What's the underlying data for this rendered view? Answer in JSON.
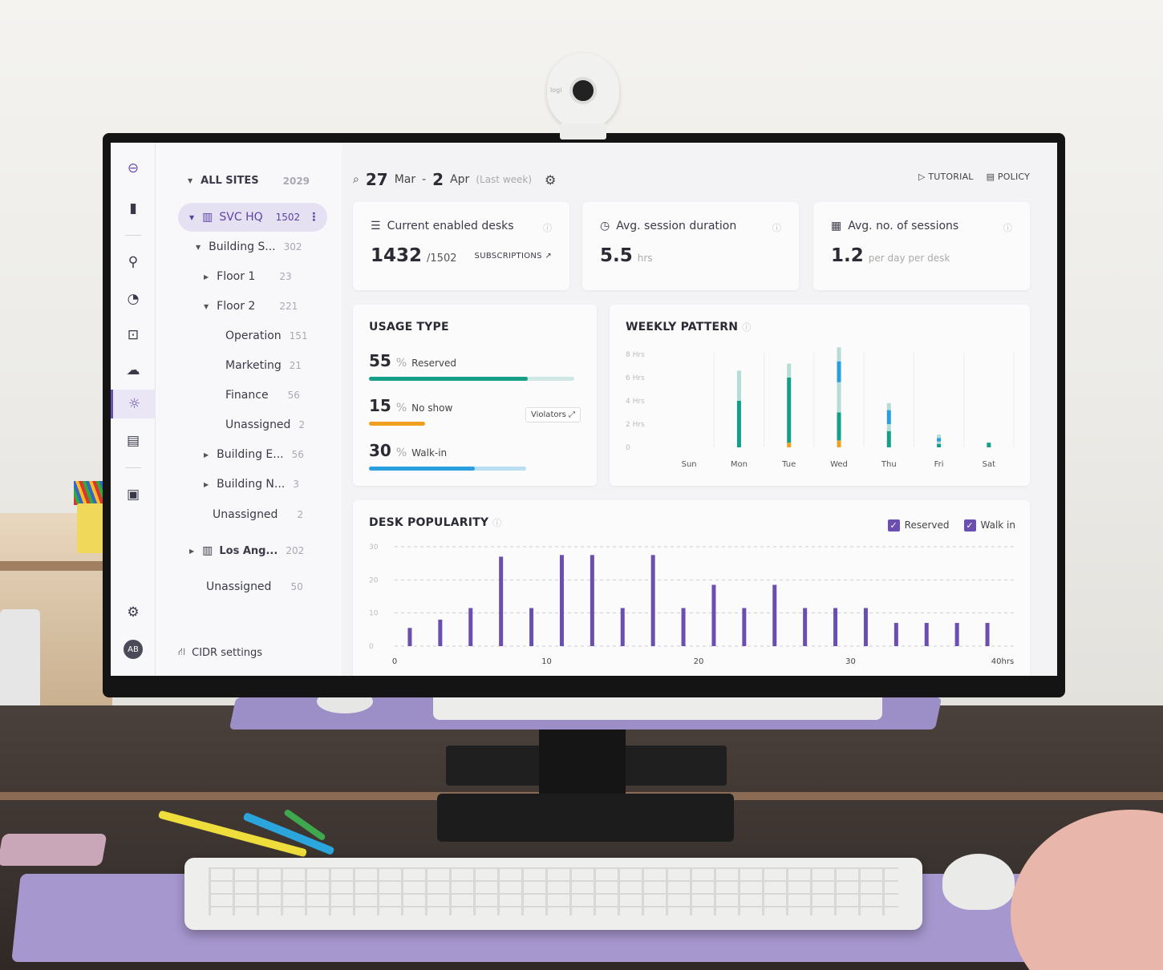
{
  "sidebar": {
    "sites_header": {
      "label": "ALL SITES",
      "count": "2029"
    },
    "tree": [
      {
        "label": "SVC HQ",
        "count": "1502"
      },
      {
        "label": "Building S...",
        "count": "302"
      },
      {
        "label": "Floor 1",
        "count": "23"
      },
      {
        "label": "Floor 2",
        "count": "221"
      },
      {
        "label": "Operation",
        "count": "151"
      },
      {
        "label": "Marketing",
        "count": "21"
      },
      {
        "label": "Finance",
        "count": "56"
      },
      {
        "label": "Unassigned",
        "count": "2"
      },
      {
        "label": "Building E...",
        "count": "56"
      },
      {
        "label": "Building N...",
        "count": "3"
      },
      {
        "label": "Unassigned",
        "count": "2"
      },
      {
        "label": "Los Ang...",
        "count": "202"
      },
      {
        "label": "Unassigned",
        "count": "50"
      }
    ],
    "cidr_label": "CIDR settings",
    "avatar": "AB"
  },
  "header": {
    "date_start_day": "27",
    "date_start_month": "Mar",
    "date_end_day": "2",
    "date_end_month": "Apr",
    "range_label": "(Last week)",
    "tutorial": "TUTORIAL",
    "policy": "POLICY"
  },
  "kpis": {
    "desks": {
      "title": "Current enabled desks",
      "value": "1432",
      "total": "/1502",
      "link": "SUBSCRIPTIONS"
    },
    "duration": {
      "title": "Avg. session duration",
      "value": "5.5",
      "unit": "hrs"
    },
    "sessions": {
      "title": "Avg. no. of sessions",
      "value": "1.2",
      "unit": "per day per desk"
    }
  },
  "usage": {
    "title": "USAGE TYPE",
    "rows": [
      {
        "value": "55",
        "pct": "%",
        "label": "Reserved",
        "color": "#14a088"
      },
      {
        "value": "15",
        "pct": "%",
        "label": "No show",
        "color": "#f0a020"
      },
      {
        "value": "30",
        "pct": "%",
        "label": "Walk-in",
        "color": "#2a9fe0"
      }
    ],
    "violators": "Violators"
  },
  "colors": {
    "accent": "#6b4fb0",
    "teal": "#14a088",
    "orange": "#f0a020",
    "blue": "#2a9fe0",
    "lightteal": "#b7dcd6"
  },
  "chart_data": [
    {
      "type": "bar",
      "title": "WEEKLY PATTERN",
      "categories": [
        "Sun",
        "Mon",
        "Tue",
        "Wed",
        "Thu",
        "Fri",
        "Sat"
      ],
      "ylim": [
        0,
        8
      ],
      "y_ticks": [
        "0",
        "2 Hrs",
        "4 Hrs",
        "6 Hrs",
        "8 Hrs"
      ],
      "stacked": true,
      "series": [
        {
          "values": [
            0,
            0,
            0.4,
            0.6,
            0,
            0,
            0
          ]
        },
        {
          "values": [
            0,
            4.0,
            5.6,
            2.4,
            1.4,
            0.3,
            0.4
          ]
        },
        {
          "values": [
            0,
            2.6,
            1.2,
            2.6,
            0.6,
            0.2,
            0
          ]
        },
        {
          "values": [
            0,
            0,
            0,
            1.8,
            1.2,
            0.3,
            0
          ]
        },
        {
          "values": [
            0,
            0,
            0,
            1.2,
            0.6,
            0.3,
            0
          ]
        }
      ]
    },
    {
      "type": "bar",
      "title": "DESK POPULARITY",
      "legend": [
        "Reserved",
        "Walk in"
      ],
      "x_ticks": [
        "0",
        "10",
        "20",
        "30",
        "40hrs"
      ],
      "y_ticks": [
        "0",
        "10",
        "20",
        "30"
      ],
      "xlim": [
        0,
        40
      ],
      "ylim": [
        0,
        30
      ],
      "x": [
        1,
        3,
        5,
        7,
        9,
        11,
        13,
        15,
        17,
        19,
        21,
        23,
        25,
        27,
        29,
        31,
        33,
        35,
        37,
        39
      ],
      "values": [
        5.5,
        8,
        11.5,
        27,
        11.5,
        27.5,
        27.5,
        11.5,
        27.5,
        11.5,
        18.5,
        11.5,
        18.5,
        11.5,
        11.5,
        11.5,
        7,
        7,
        7,
        7
      ]
    }
  ]
}
